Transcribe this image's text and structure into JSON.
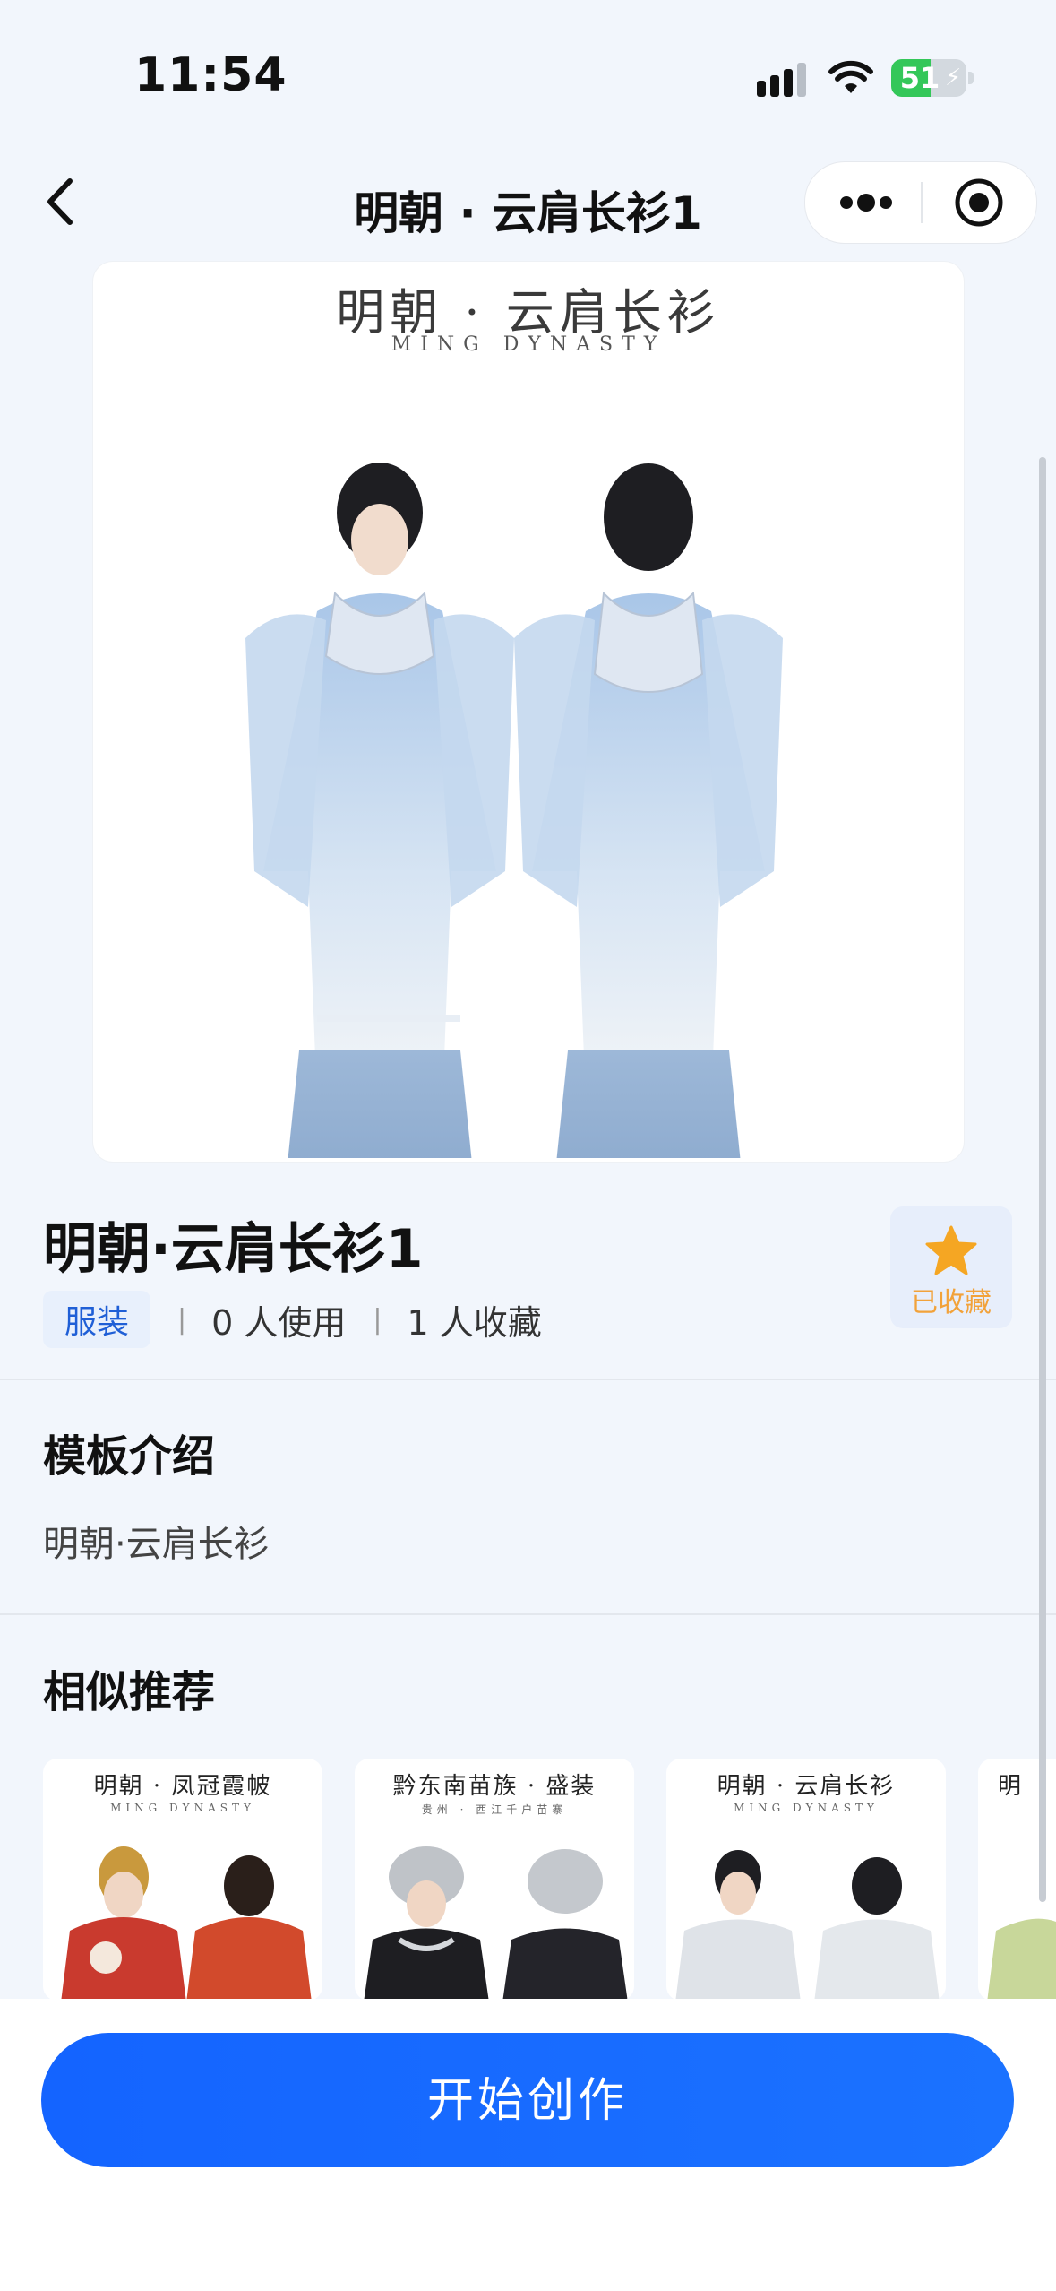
{
  "status_bar": {
    "time": "11:54",
    "battery": "51"
  },
  "nav": {
    "title": "明朝 · 云肩长衫1"
  },
  "hero": {
    "title": "明朝 · 云肩长衫",
    "subtitle": "MING DYNASTY"
  },
  "detail": {
    "title": "明朝·云肩长衫1",
    "category": "服装",
    "usage": "0 人使用",
    "favorites": "1 人收藏",
    "favorite_label": "已收藏"
  },
  "intro": {
    "heading": "模板介绍",
    "text": "明朝·云肩长衫"
  },
  "recommend": {
    "heading": "相似推荐",
    "items": [
      {
        "title": "明朝 · 凤冠霞帔",
        "subtitle": "MING DYNASTY"
      },
      {
        "title": "黔东南苗族 · 盛装",
        "subtitle": "贵州 · 西江千户苗寨"
      },
      {
        "title": "明朝 · 云肩长衫",
        "subtitle": "MING DYNASTY"
      },
      {
        "title": "明",
        "subtitle": ""
      }
    ]
  },
  "cta": {
    "label": "开始创作"
  },
  "colors": {
    "accent": "#1b6bff",
    "favorite": "#f5a623",
    "tag_bg": "#e8f0fc"
  }
}
